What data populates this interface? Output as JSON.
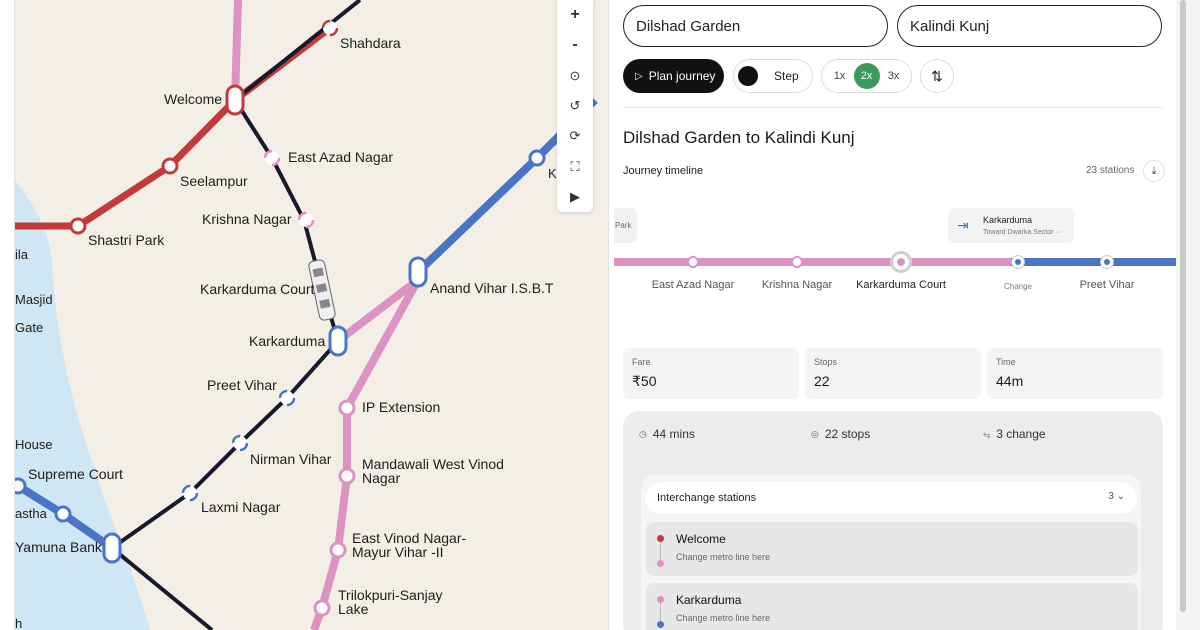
{
  "map": {
    "stations": [
      {
        "name": "Shahdara"
      },
      {
        "name": "Welcome"
      },
      {
        "name": "East Azad Nagar"
      },
      {
        "name": "Seelampur"
      },
      {
        "name": "Krishna Nagar"
      },
      {
        "name": "Shastri Park"
      },
      {
        "name": "Karkarduma Court"
      },
      {
        "name": "Anand Vihar I.S.B.T"
      },
      {
        "name": "Karkarduma"
      },
      {
        "name": "Preet Vihar"
      },
      {
        "name": "IP Extension"
      },
      {
        "name": "Nirman Vihar"
      },
      {
        "name": "Mandawali West Vinod"
      },
      {
        "name": "Nagar"
      },
      {
        "name": "Laxmi Nagar"
      },
      {
        "name": "Supreme Court"
      },
      {
        "name": "Yamuna Bank"
      },
      {
        "name": "East Vinod Nagar-"
      },
      {
        "name": "Mayur Vihar -II"
      },
      {
        "name": "Trilokpuri-Sanjay"
      },
      {
        "name": "Lake"
      }
    ],
    "edge_labels": [
      "ila",
      "Masjid",
      "Gate",
      "House",
      "astha",
      "h",
      "K"
    ],
    "colors": {
      "red": "#c23b3b",
      "pink": "#dc92c2",
      "blue": "#4a74c4",
      "dark": "#161a2b",
      "river": "#cfe6f4"
    }
  },
  "toolbar": {
    "items": [
      {
        "name": "zoom-in-icon",
        "glyph": "+"
      },
      {
        "name": "zoom-out-icon",
        "glyph": "-"
      },
      {
        "name": "locate-icon",
        "glyph": "⊙"
      },
      {
        "name": "undo-icon",
        "glyph": "↺"
      },
      {
        "name": "refresh-icon",
        "glyph": "⟳"
      },
      {
        "name": "fullscreen-icon",
        "glyph": "⛶"
      },
      {
        "name": "play-video-icon",
        "glyph": "▶"
      }
    ]
  },
  "search": {
    "from": "Dilshad Garden",
    "to": "Kalindi Kunj"
  },
  "controls": {
    "plan_label": "Plan journey",
    "plan_icon": "▷",
    "step_label": "Step",
    "speeds": [
      "1x",
      "2x",
      "3x"
    ],
    "active_speed": "2x",
    "swap_icon": "⇅"
  },
  "journey": {
    "title": "Dilshad Garden to Kalindi Kunj",
    "timeline_label": "Journey timeline",
    "station_count": "23 stations",
    "download_icon": "⤓",
    "left_chip": "Park",
    "current_chip": {
      "icon": "⇥",
      "name": "Karkarduma",
      "direction": "Toward Dwarka Sector ···"
    },
    "timeline": [
      {
        "label": "East Azad Nagar",
        "type": "stop"
      },
      {
        "label": "Krishna Nagar",
        "type": "stop"
      },
      {
        "label": "Karkarduma Court",
        "type": "current"
      },
      {
        "label": "Change",
        "type": "change"
      },
      {
        "label": "Preet Vihar",
        "type": "stop"
      }
    ]
  },
  "stats": [
    {
      "label": "Fare",
      "value": "₹50"
    },
    {
      "label": "Stops",
      "value": "22"
    },
    {
      "label": "Time",
      "value": "44m"
    }
  ],
  "summary": {
    "time": "44 mins",
    "stops": "22 stops",
    "changes": "3 change",
    "time_icon": "◷",
    "stops_icon": "◎",
    "change_icon": "⥃"
  },
  "interchange": {
    "title": "Interchange stations",
    "count": "3",
    "chevron": "⌄",
    "stations": [
      {
        "name": "Welcome",
        "subtitle": "Change metro line here",
        "from_color": "#c23b3b",
        "to_color": "#dc92c2"
      },
      {
        "name": "Karkarduma",
        "subtitle": "Change metro line here",
        "from_color": "#dc92c2",
        "to_color": "#4a74c4"
      }
    ]
  }
}
